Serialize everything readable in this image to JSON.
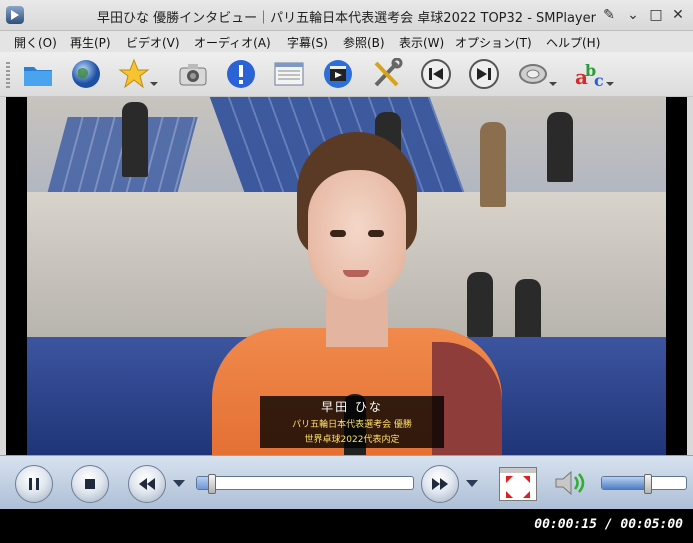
{
  "window": {
    "title": "早田ひな 優勝インタビュー｜パリ五輪日本代表選考会 卓球2022 TOP32 - SMPlayer",
    "buttons": {
      "pin": "✎",
      "minimize": "⌄",
      "restore": "⌃",
      "maximize": "□",
      "close": "✕"
    }
  },
  "menu": [
    "開く(O)",
    "再生(P)",
    "ビデオ(V)",
    "オーディオ(A)",
    "字幕(S)",
    "参照(B)",
    "表示(W)",
    "オプション(T)",
    "ヘルプ(H)"
  ],
  "toolbar": [
    {
      "name": "open-folder-icon"
    },
    {
      "name": "open-url-globe-icon"
    },
    {
      "name": "favorites-star-icon"
    },
    {
      "name": "screenshot-camera-icon"
    },
    {
      "name": "info-icon"
    },
    {
      "name": "playlist-icon"
    },
    {
      "name": "video-clapper-icon"
    },
    {
      "name": "preferences-tools-icon"
    },
    {
      "name": "previous-track-icon"
    },
    {
      "name": "next-track-icon"
    },
    {
      "name": "audio-track-icon"
    },
    {
      "name": "subtitles-abc-icon"
    }
  ],
  "video": {
    "caption_name": "早田 ひな",
    "caption_line1": "パリ五輪日本代表選考会 優勝",
    "caption_line2": "世界卓球2022代表内定"
  },
  "controls": {
    "progress_fraction": 0.05,
    "volume_fraction": 0.5
  },
  "status": {
    "time": "00:00:15 / 00:05:00"
  },
  "colors": {
    "control_bar": "#c3d1e3",
    "caption_text": "#ffe066",
    "status_bg": "#000000"
  }
}
